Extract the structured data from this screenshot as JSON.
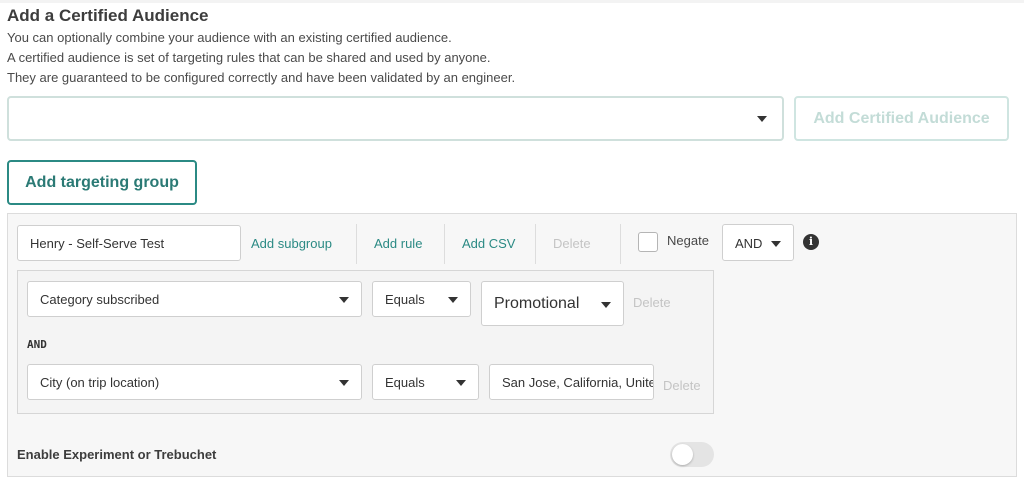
{
  "certified": {
    "title": "Add a Certified Audience",
    "description": [
      "You can optionally combine your audience with an existing certified audience.",
      "A certified audience is set of targeting rules that can be shared and used by anyone.",
      "They are guaranteed to be configured correctly and have been validated by an engineer."
    ],
    "select_value": "",
    "add_button_label": "Add Certified Audience"
  },
  "add_group_label": "Add targeting group",
  "group": {
    "name_value": "Henry - Self-Serve Test",
    "actions": {
      "add_subgroup": "Add subgroup",
      "add_rule": "Add rule",
      "add_csv": "Add CSV",
      "delete": "Delete"
    },
    "negate_label": "Negate",
    "negate_checked": false,
    "operator": "AND",
    "info_icon": "info-icon",
    "subgroup": {
      "rules": [
        {
          "field": "Category subscribed",
          "comparator": "Equals",
          "value": "Promotional",
          "delete": "Delete"
        },
        {
          "field": "City (on trip location)",
          "comparator": "Equals",
          "value": "San Jose, California, United States",
          "delete": "Delete"
        }
      ],
      "connector": "AND"
    },
    "experiment_label": "Enable Experiment or Trebuchet",
    "experiment_enabled": false
  },
  "colors": {
    "accent": "#2b8a84",
    "disabled_text": "#c4c4c4",
    "panel_bg": "#f7f7f7"
  }
}
